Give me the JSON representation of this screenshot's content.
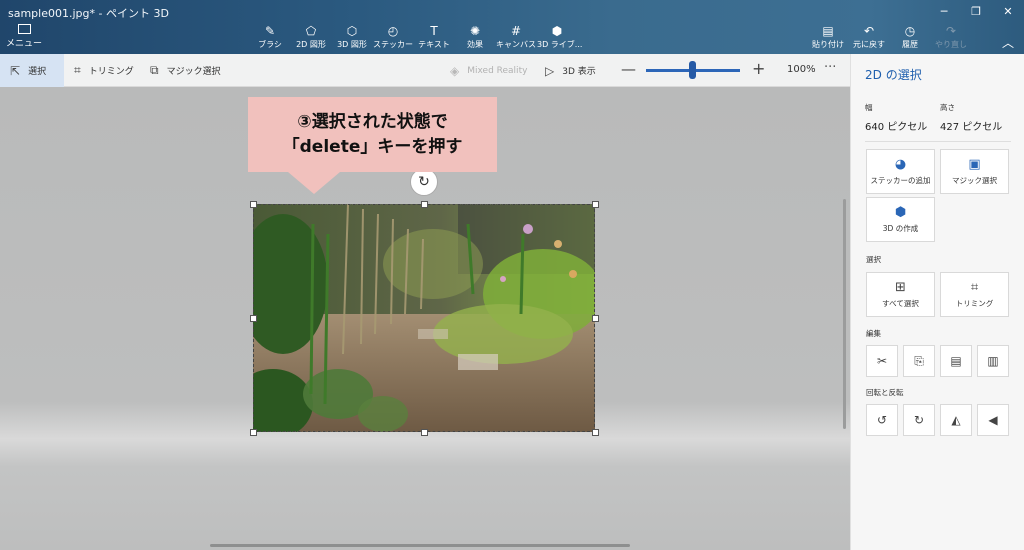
{
  "window": {
    "title": "sample001.jpg* - ペイント 3D",
    "controls": [
      "─",
      "❐",
      "✕"
    ]
  },
  "ribbon": {
    "menu_label": "メニュー",
    "tools": [
      {
        "label": "ブラシ",
        "icon": "brush-icon",
        "glyph": "✎"
      },
      {
        "label": "2D 図形",
        "icon": "shapes-2d-icon",
        "glyph": "⬠"
      },
      {
        "label": "3D 図形",
        "icon": "shapes-3d-icon",
        "glyph": "⬡"
      },
      {
        "label": "ステッカー",
        "icon": "sticker-icon",
        "glyph": "◴"
      },
      {
        "label": "テキスト",
        "icon": "text-icon",
        "glyph": "T"
      },
      {
        "label": "効果",
        "icon": "effects-icon",
        "glyph": "✺"
      },
      {
        "label": "キャンバス",
        "icon": "canvas-icon",
        "glyph": "#"
      },
      {
        "label": "3D ライブ...",
        "icon": "3d-library-icon",
        "glyph": "⬢"
      }
    ],
    "right_tools": [
      {
        "label": "貼り付け",
        "icon": "paste-icon",
        "glyph": "▤",
        "disabled": false
      },
      {
        "label": "元に戻す",
        "icon": "undo-icon",
        "glyph": "↶",
        "disabled": false
      },
      {
        "label": "履歴",
        "icon": "history-icon",
        "glyph": "◷",
        "disabled": false
      },
      {
        "label": "やり直し",
        "icon": "redo-icon",
        "glyph": "↷",
        "disabled": true
      }
    ],
    "collapse_glyph": "︿"
  },
  "optionsbar": {
    "select_label": "選択",
    "trim_label": "トリミング",
    "magic_label": "マジック選択",
    "mixed_reality_label": "Mixed Reality",
    "view3d_label": "3D 表示",
    "zoom_value": "100%",
    "zoom_fraction": 0.5,
    "more_glyph": "···"
  },
  "callout": {
    "line1": "③選択された状態で",
    "line2": "「delete」キーを押す"
  },
  "panel": {
    "title": "2D の選択",
    "width_label": "幅",
    "width_value": "640 ピクセル",
    "height_label": "高さ",
    "height_value": "427 ピクセル",
    "add_sticker": "ステッカーの追加",
    "magic_select": "マジック選択",
    "make_3d": "3D の作成",
    "section_select": "選択",
    "select_all": "すべて選択",
    "trimming": "トリミング",
    "section_edit": "編集",
    "section_rotate": "回転と反転"
  },
  "colors": {
    "accent": "#1f5fae",
    "callout": "#f1c1bd"
  }
}
